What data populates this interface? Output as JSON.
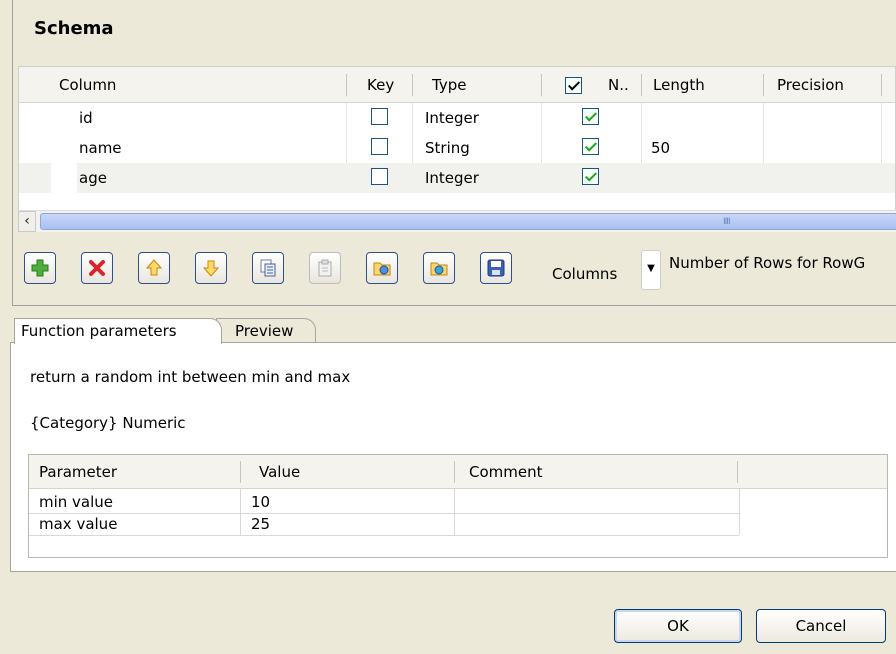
{
  "schema": {
    "title": "Schema",
    "columns": [
      "Column",
      "Key",
      "Type",
      "N..",
      "Length",
      "Precision"
    ],
    "rows": [
      {
        "column": "id",
        "key": false,
        "type": "Integer",
        "nullable": true,
        "length": "",
        "precision": ""
      },
      {
        "column": "name",
        "key": false,
        "type": "String",
        "nullable": true,
        "length": "50",
        "precision": ""
      },
      {
        "column": "age",
        "key": false,
        "type": "Integer",
        "nullable": true,
        "length": "",
        "precision": ""
      }
    ],
    "scroll_grip": "IIII"
  },
  "toolbar": {
    "buttons": [
      "add-icon",
      "delete-icon",
      "move-up-icon",
      "move-down-icon",
      "copy-icon",
      "paste-icon",
      "import-icon",
      "export-icon",
      "save-icon"
    ],
    "columns_label": "Columns",
    "columns_arrow": "▼",
    "rows_label": "Number of Rows for RowG"
  },
  "tabs": {
    "function_parameters": "Function parameters",
    "preview": "Preview"
  },
  "function": {
    "description": "return a random int between min and max",
    "category": "{Category} Numeric"
  },
  "params": {
    "headers": [
      "Parameter",
      "Value",
      "Comment"
    ],
    "rows": [
      {
        "parameter": "min value",
        "value": "10",
        "comment": ""
      },
      {
        "parameter": "max value",
        "value": "25",
        "comment": ""
      }
    ]
  },
  "dialog": {
    "ok_label": "OK",
    "cancel_label": "Cancel"
  },
  "colors": {
    "background": "#ece9d8",
    "checkmark": "#21a121",
    "scroll_thumb": "#a9c0ef"
  }
}
